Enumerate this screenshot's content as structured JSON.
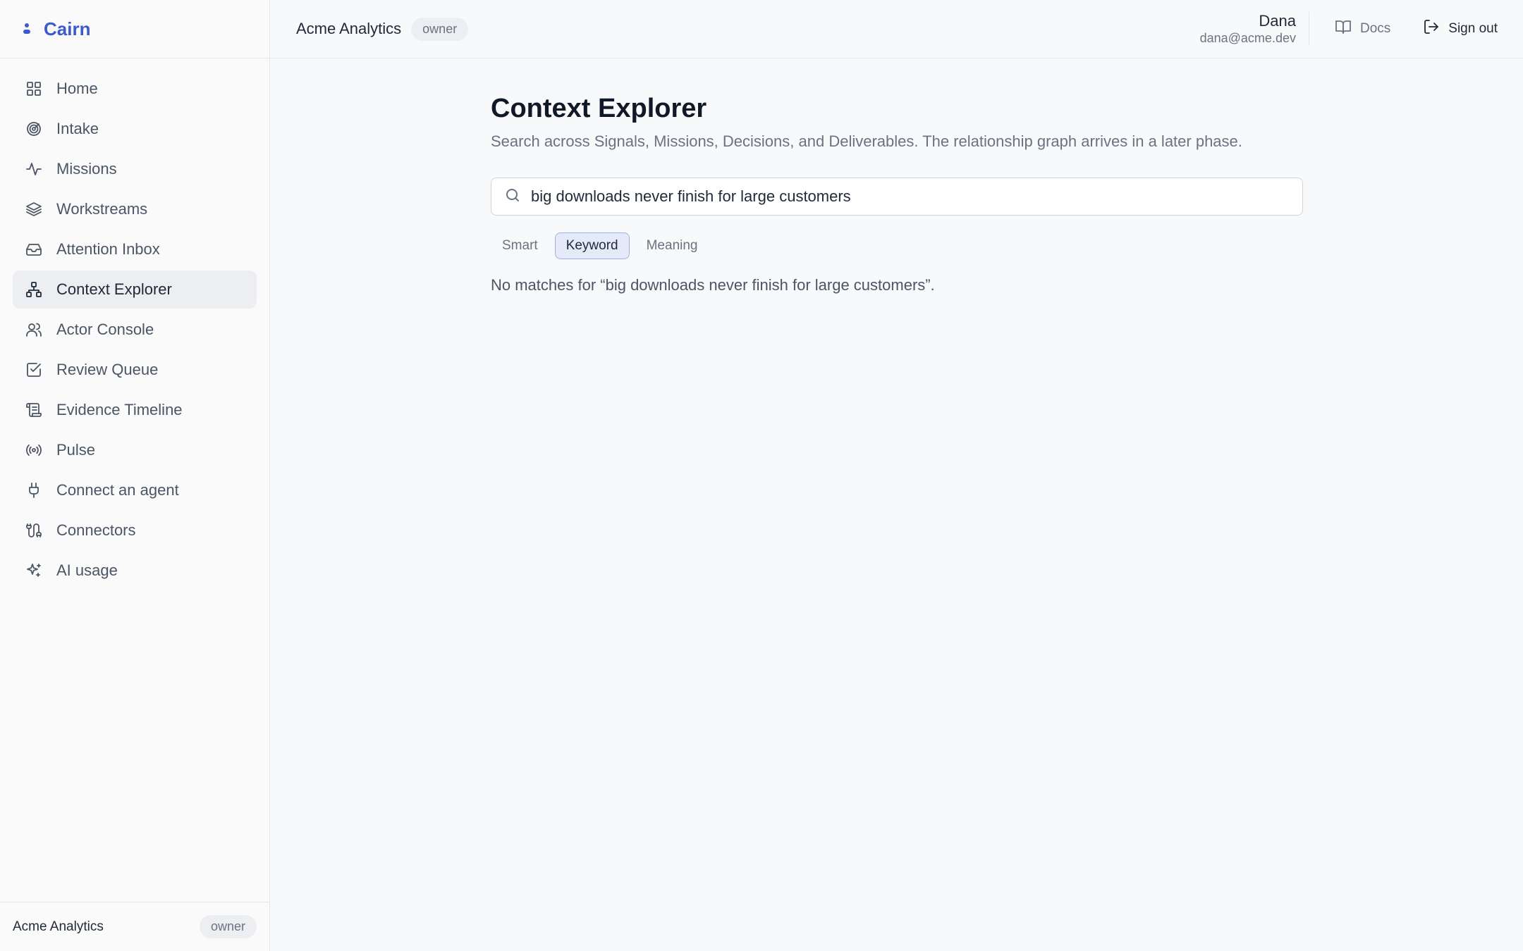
{
  "brand": {
    "name": "Cairn"
  },
  "sidebar": {
    "items": [
      {
        "label": "Home",
        "icon": "grid-icon"
      },
      {
        "label": "Intake",
        "icon": "target-icon"
      },
      {
        "label": "Missions",
        "icon": "activity-icon"
      },
      {
        "label": "Workstreams",
        "icon": "layers-icon"
      },
      {
        "label": "Attention Inbox",
        "icon": "inbox-icon"
      },
      {
        "label": "Context Explorer",
        "icon": "network-icon",
        "active": true
      },
      {
        "label": "Actor Console",
        "icon": "users-icon"
      },
      {
        "label": "Review Queue",
        "icon": "check-square-icon"
      },
      {
        "label": "Evidence Timeline",
        "icon": "scroll-icon"
      },
      {
        "label": "Pulse",
        "icon": "radio-icon"
      },
      {
        "label": "Connect an agent",
        "icon": "plug-icon"
      },
      {
        "label": "Connectors",
        "icon": "cable-icon"
      },
      {
        "label": "AI usage",
        "icon": "sparkles-icon"
      }
    ],
    "footer": {
      "org": "Acme Analytics",
      "role": "owner"
    }
  },
  "topbar": {
    "org": "Acme Analytics",
    "role": "owner",
    "user": {
      "name": "Dana",
      "email": "dana@acme.dev"
    },
    "docs_label": "Docs",
    "signout_label": "Sign out"
  },
  "page": {
    "title": "Context Explorer",
    "subtitle": "Search across Signals, Missions, Decisions, and Deliverables. The relationship graph arrives in a later phase.",
    "search": {
      "value": "big downloads never finish for large customers",
      "placeholder": ""
    },
    "modes": [
      "Smart",
      "Keyword",
      "Meaning"
    ],
    "active_mode": "Keyword",
    "empty_message": "No matches for “big downloads never finish for large customers”."
  },
  "colors": {
    "accent": "#3b5bcc",
    "active_mode_bg": "#e5eaf8",
    "active_nav_bg": "#eceef2"
  }
}
